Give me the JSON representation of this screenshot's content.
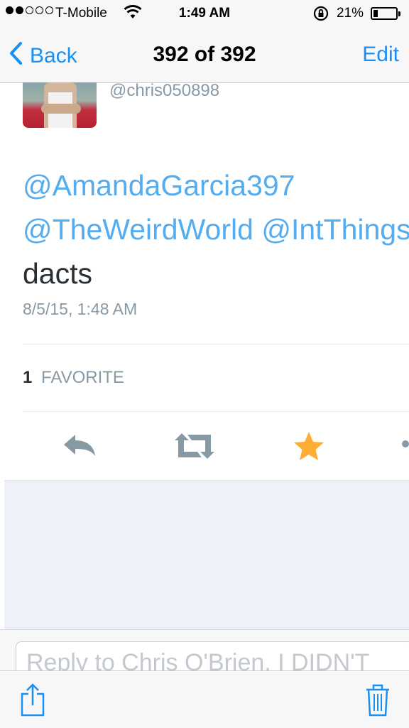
{
  "status_bar": {
    "carrier": "T-Mobile",
    "time": "1:49 AM",
    "battery_percent": "21%",
    "battery_level": 0.21,
    "signal_bars_filled": 2,
    "signal_bars_total": 5,
    "icons": [
      "wifi-icon",
      "rotation-lock-icon",
      "battery-icon"
    ]
  },
  "nav": {
    "back_label": "Back",
    "title": "392 of 392",
    "edit_label": "Edit"
  },
  "tweet": {
    "handle": "@chris050898",
    "mentions": [
      "@AmandaGarcia397",
      "@TheWeirdWorld",
      "@IntThings"
    ],
    "text": "dacts",
    "timestamp": "8/5/15, 1:48 AM",
    "favorite_count": "1",
    "favorite_label": "FAVORITE"
  },
  "actions": {
    "icons": [
      "reply-icon",
      "retweet-icon",
      "favorite-star-icon",
      "more-icon"
    ],
    "colors": {
      "inactive": "#8899a6",
      "favorited": "#ffac33"
    }
  },
  "reply": {
    "placeholder": "Reply to Chris O'Brien, I DIDN'T"
  },
  "toolbar": {
    "icons": [
      "share-icon",
      "trash-icon"
    ]
  },
  "colors": {
    "accent": "#1a8ff2",
    "mention": "#55acee",
    "secondary_text": "#8899a6"
  }
}
